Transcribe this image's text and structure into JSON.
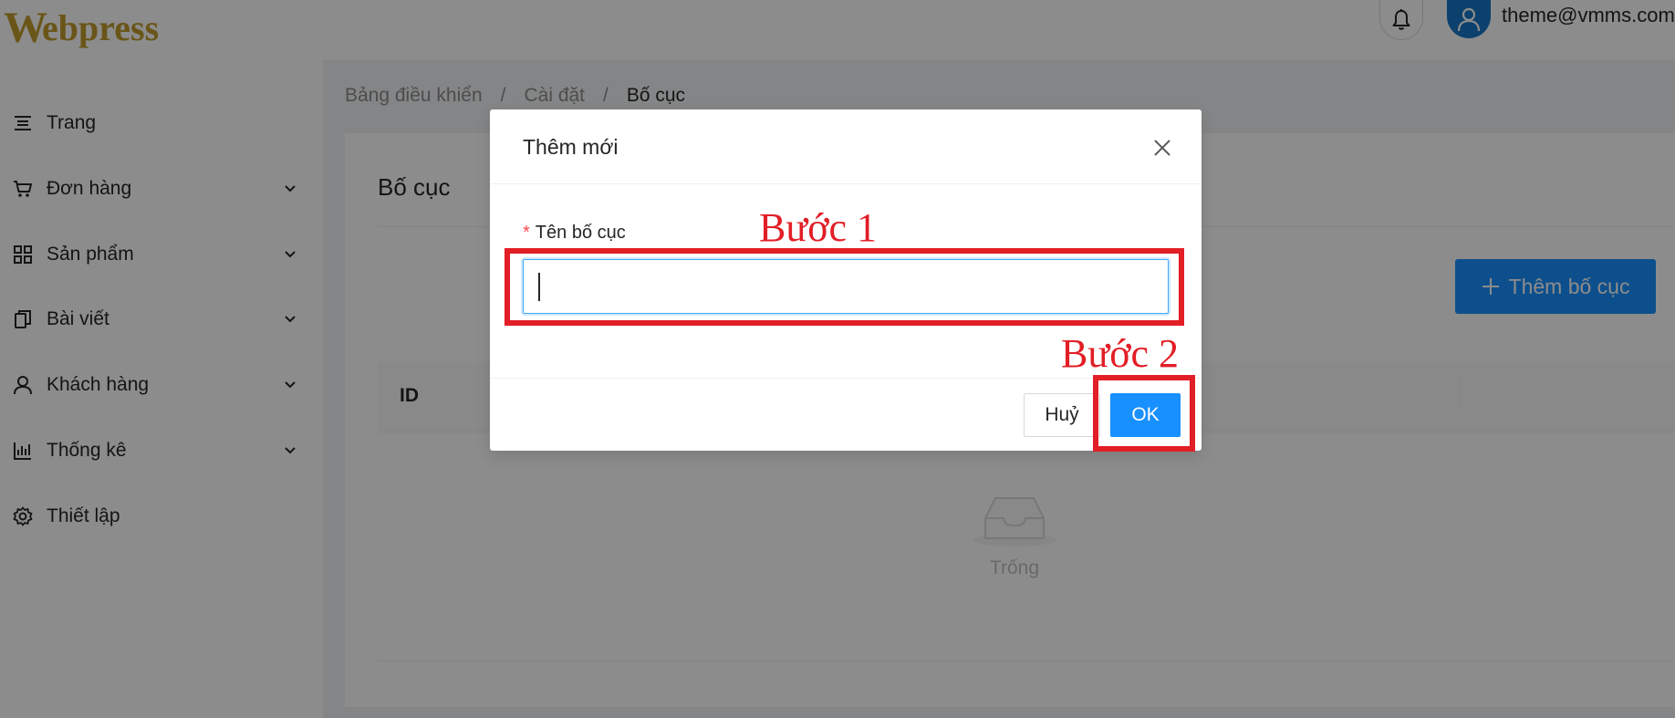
{
  "header": {
    "logo_initial": "W",
    "logo_rest": "ebpress",
    "user_email": "theme@vmms.com.v",
    "icons": {
      "bell": "bell-icon",
      "avatar": "user-icon"
    }
  },
  "sidebar": {
    "items": [
      {
        "label": "Trang",
        "icon": "menu-lines-icon",
        "has_submenu": false
      },
      {
        "label": "Đơn hàng",
        "icon": "cart-icon",
        "has_submenu": true
      },
      {
        "label": "Sản phẩm",
        "icon": "grid-icon",
        "has_submenu": true
      },
      {
        "label": "Bài viết",
        "icon": "copy-icon",
        "has_submenu": true
      },
      {
        "label": "Khách hàng",
        "icon": "user-icon",
        "has_submenu": true
      },
      {
        "label": "Thống kê",
        "icon": "bar-chart-icon",
        "has_submenu": true
      },
      {
        "label": "Thiết lập",
        "icon": "gear-icon",
        "has_submenu": false
      }
    ]
  },
  "breadcrumb": {
    "items": [
      "Bảng điều khiển",
      "Cài đặt",
      "Bố cục"
    ],
    "separator": "/"
  },
  "page": {
    "title": "Bố cục",
    "add_button_label": "Thêm bố cục",
    "table": {
      "columns": [
        "ID"
      ],
      "empty_text": "Trống"
    }
  },
  "modal": {
    "title": "Thêm mới",
    "field_label": "Tên bố cục",
    "required_mark": "*",
    "input_value": "",
    "cancel_label": "Huỷ",
    "ok_label": "OK"
  },
  "annotations": {
    "step1": "Bước 1",
    "step2": "Bước 2",
    "color": "#e21e26"
  },
  "colors": {
    "primary": "#1890ff",
    "brand_gold": "#c29b2e",
    "avatar_bg": "#1677c8"
  }
}
